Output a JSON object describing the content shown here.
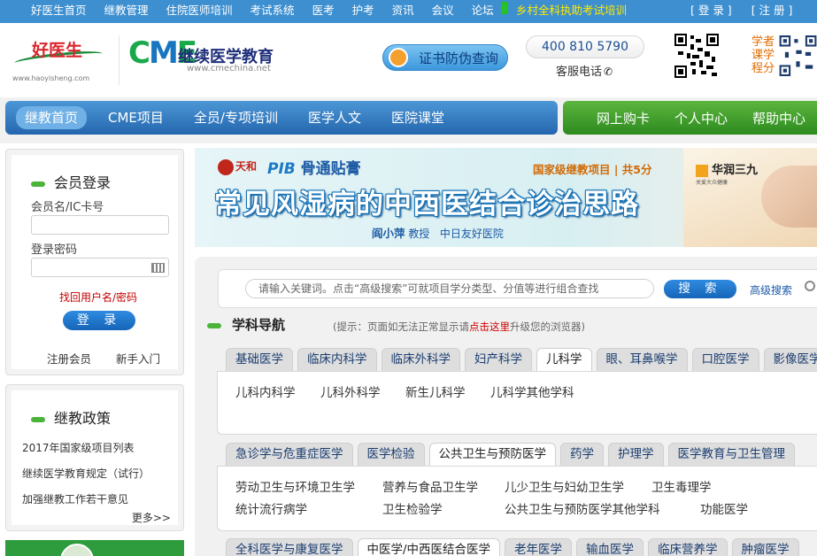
{
  "topbar": {
    "links": [
      "好医生首页",
      "继教管理",
      "住院医师培训",
      "考试系统",
      "医考",
      "护考",
      "资讯",
      "会议",
      "论坛"
    ],
    "rural_link": "乡村全科执助考试培训",
    "login": "[ 登 录 ]",
    "register": "[ 注 册 ]"
  },
  "header": {
    "logo1_text": "好医生",
    "logo1_url": "www.haoyisheng.com",
    "logo2_cme_c": "C",
    "logo2_cme_m": "M",
    "logo2_cme_e": "E",
    "logo2_text": "继续医学教育",
    "logo2_url": "www.cmechina.net",
    "cert_button": "证书防伪查询",
    "phone": "400 810 5790",
    "phone_label": "客服电话",
    "learn_label": "学者课学程分"
  },
  "main_nav": {
    "blue_items": [
      "继教首页",
      "CME项目",
      "全员/专项培训",
      "医学人文",
      "医院课堂"
    ],
    "green_items": [
      "网上购卡",
      "个人中心",
      "帮助中心"
    ]
  },
  "login_box": {
    "title": "会员登录",
    "username_label": "会员名/IC卡号",
    "password_label": "登录密码",
    "forgot": "找回用户名/密码",
    "login_button": "登 录",
    "register": "注册会员",
    "guide": "新手入门"
  },
  "policy_box": {
    "title": "继教政策",
    "items": [
      "2017年国家级项目列表",
      "继续医学教育规定（试行）",
      "加强继教工作若干意见"
    ],
    "more": "更多>>"
  },
  "banner": {
    "logo1": "天和",
    "logo2_brand": "PIB",
    "logo2_text": "骨通贴膏",
    "tag": "国家级继教项目 | 共5分",
    "title": "常见风湿病的中西医结合诊治思路",
    "author_name": "阎小萍",
    "author_title": "教授",
    "author_hospital": "中日友好医院",
    "brand": "华润三九",
    "slogan": "关爱大众健康"
  },
  "search": {
    "placeholder": "请输入关键词。点击“高级搜索”可就项目学分类型、分值等进行组合查找",
    "button": "搜 索",
    "advanced": "高级搜索"
  },
  "discipline_nav": {
    "title": "学科导航",
    "hint_prefix": "(提示：页面如无法正常显示请",
    "hint_link": "点击这里",
    "hint_suffix": "升级您的浏览器)"
  },
  "tab_groups": [
    {
      "tabs": [
        "基础医学",
        "临床内科学",
        "临床外科学",
        "妇产科学",
        "儿科学",
        "眼、耳鼻喉学",
        "口腔医学",
        "影像医学"
      ],
      "active": 4,
      "rows": [
        [
          "儿科内科学",
          "儿科外科学",
          "新生儿科学",
          "儿科学其他学科"
        ]
      ]
    },
    {
      "tabs": [
        "急诊学与危重症医学",
        "医学检验",
        "公共卫生与预防医学",
        "药学",
        "护理学",
        "医学教育与卫生管理"
      ],
      "active": 2,
      "rows": [
        [
          "劳动卫生与环境卫生学",
          "营养与食品卫生学",
          "儿少卫生与妇幼卫生学",
          "卫生毒理学"
        ],
        [
          "统计流行病学",
          "卫生检验学",
          "公共卫生与预防医学其他学科",
          "功能医学"
        ]
      ]
    },
    {
      "tabs": [
        "全科医学与康复医学",
        "中医学/中西医结合医学",
        "老年医学",
        "输血医学",
        "临床营养学",
        "肿瘤医学"
      ],
      "active": 1,
      "rows": []
    }
  ]
}
